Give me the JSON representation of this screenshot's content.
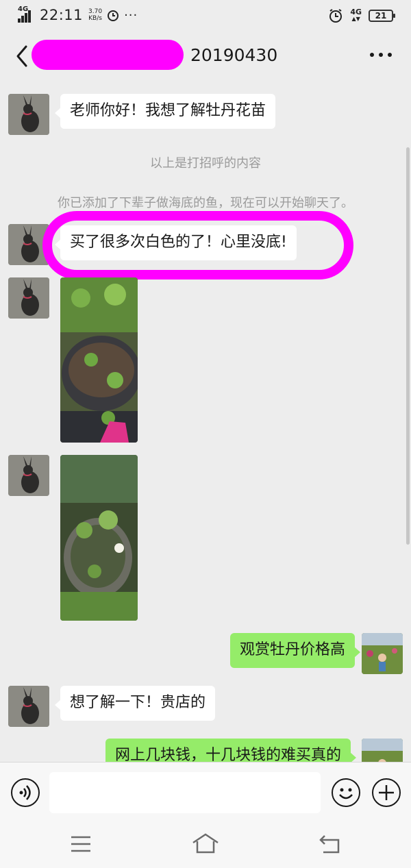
{
  "status_bar": {
    "network_left": "4G",
    "time": "22:11",
    "speed_value": "3.70",
    "speed_unit": "KB/s",
    "network_right": "4G",
    "battery": "21"
  },
  "header": {
    "title_suffix": "20190430"
  },
  "messages": [
    {
      "side": "left",
      "type": "text",
      "text": "老师你好！我想了解牡丹花苗"
    },
    {
      "type": "system",
      "text": "以上是打招呼的内容"
    },
    {
      "type": "system",
      "text": "你已添加了下辈子做海底的鱼，现在可以开始聊天了。"
    },
    {
      "side": "left",
      "type": "text",
      "text": "买了很多次白色的了！心里没底!"
    },
    {
      "side": "left",
      "type": "image",
      "subject": "potted seedlings with a pink shoe"
    },
    {
      "side": "left",
      "type": "image",
      "subject": "small white flower in a pot"
    },
    {
      "side": "right",
      "type": "text",
      "text": "观赏牡丹价格高"
    },
    {
      "side": "left",
      "type": "text",
      "text": "想了解一下！贵店的"
    },
    {
      "side": "right",
      "type": "text",
      "text": "网上几块钱，十几块钱的难买真的"
    }
  ],
  "input": {
    "value": "",
    "placeholder": ""
  },
  "icons": {
    "back": "chevron-left-icon",
    "more": "more-dots-icon",
    "voice": "voice-icon",
    "emoji": "emoji-icon",
    "plus": "plus-icon",
    "menu": "menu-icon",
    "home": "home-icon",
    "return": "return-icon"
  },
  "colors": {
    "sent_bubble": "#95ec69",
    "received_bubble": "#ffffff",
    "background": "#ededed",
    "redaction": "#ff00ff"
  }
}
